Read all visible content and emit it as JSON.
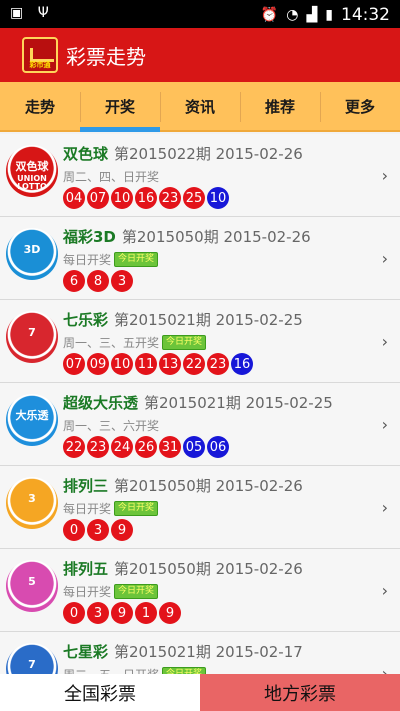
{
  "status": {
    "time": "14:32",
    "usb_icon": "usb-icon",
    "wifi_icon": "wifi-icon",
    "signal_icon": "signal-icon",
    "battery_icon": "battery-icon",
    "alarm_icon": "alarm-icon",
    "image_icon": "image-icon"
  },
  "app": {
    "title": "彩票走势",
    "logo_text": "彩市通"
  },
  "tabs": [
    {
      "label": "走势"
    },
    {
      "label": "开奖",
      "active": true
    },
    {
      "label": "资讯"
    },
    {
      "label": "推荐"
    },
    {
      "label": "更多"
    }
  ],
  "lotteries": [
    {
      "name": "双色球",
      "issue": "第2015022期",
      "date": "2015-02-26",
      "schedule": "周二、四、日开奖",
      "today": "",
      "logo_text": "双色球",
      "logo_sub": "UNION LOTTO",
      "logo_color": "#d71616",
      "red": [
        "04",
        "07",
        "10",
        "16",
        "23",
        "25"
      ],
      "blue": [
        "10"
      ]
    },
    {
      "name": "福彩3D",
      "issue": "第2015050期",
      "date": "2015-02-26",
      "schedule": "每日开奖",
      "today": "今日开奖",
      "logo_text": "3D",
      "logo_sub": "",
      "logo_color": "#1a8fd6",
      "red": [
        "6",
        "8",
        "3"
      ],
      "blue": []
    },
    {
      "name": "七乐彩",
      "issue": "第2015021期",
      "date": "2015-02-25",
      "schedule": "周一、三、五开奖",
      "today": "今日开奖",
      "logo_text": "7",
      "logo_sub": "",
      "logo_color": "#d8262e",
      "red": [
        "07",
        "09",
        "10",
        "11",
        "13",
        "22",
        "23"
      ],
      "blue": [
        "16"
      ]
    },
    {
      "name": "超级大乐透",
      "issue": "第2015021期",
      "date": "2015-02-25",
      "schedule": "周一、三、六开奖",
      "today": "",
      "logo_text": "大乐透",
      "logo_sub": "",
      "logo_color": "#1e8fdc",
      "red": [
        "22",
        "23",
        "24",
        "26",
        "31"
      ],
      "blue": [
        "05",
        "06"
      ]
    },
    {
      "name": "排列三",
      "issue": "第2015050期",
      "date": "2015-02-26",
      "schedule": "每日开奖",
      "today": "今日开奖",
      "logo_text": "3",
      "logo_sub": "",
      "logo_color": "#f5a623",
      "red": [
        "0",
        "3",
        "9"
      ],
      "blue": []
    },
    {
      "name": "排列五",
      "issue": "第2015050期",
      "date": "2015-02-26",
      "schedule": "每日开奖",
      "today": "今日开奖",
      "logo_text": "5",
      "logo_sub": "",
      "logo_color": "#d84bb0",
      "red": [
        "0",
        "3",
        "9",
        "1",
        "9"
      ],
      "blue": []
    },
    {
      "name": "七星彩",
      "issue": "第2015021期",
      "date": "2015-02-17",
      "schedule": "周二、五、日开奖",
      "today": "今日开奖",
      "logo_text": "7",
      "logo_sub": "",
      "logo_color": "#2a6cc8",
      "red": [],
      "blue": []
    }
  ],
  "bottom": {
    "national": "全国彩票",
    "local": "地方彩票"
  }
}
